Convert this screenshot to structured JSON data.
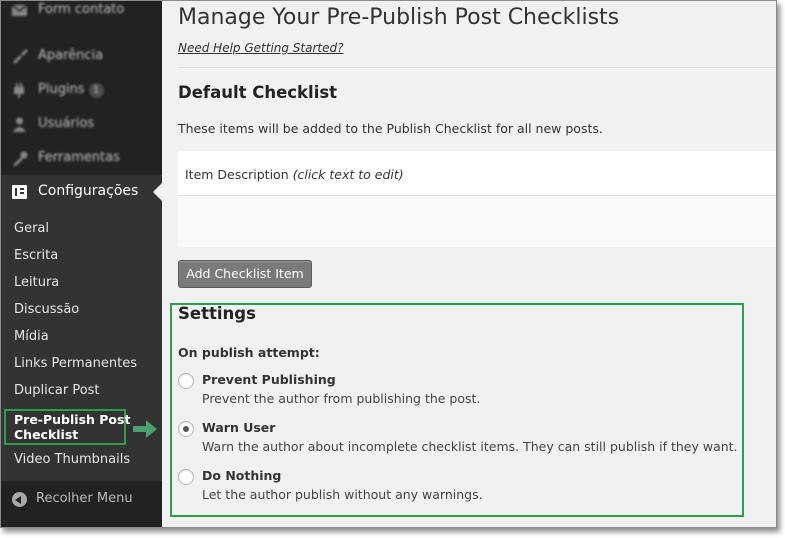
{
  "sidebar": {
    "top_items": [
      {
        "label": "Form contato",
        "icon": "mail-icon"
      },
      {
        "label": "Aparência",
        "icon": "paintbrush-icon"
      },
      {
        "label": "Plugins",
        "icon": "plug-icon",
        "badge": "1"
      },
      {
        "label": "Usuários",
        "icon": "users-icon"
      },
      {
        "label": "Ferramentas",
        "icon": "wrench-icon"
      }
    ],
    "current_menu": {
      "label": "Configurações",
      "icon": "settings-sliders-icon"
    },
    "submenu": [
      "Geral",
      "Escrita",
      "Leitura",
      "Discussão",
      "Mídia",
      "Links Permanentes",
      "Duplicar Post"
    ],
    "current_sub_line1": "Pre-Publish Post",
    "current_sub_line2": "Checklist",
    "after_current": "Video Thumbnails",
    "collapse_label": "Recolher Menu",
    "highlight_color": "#2e9e4e"
  },
  "main": {
    "title": "Manage Your Pre-Publish Post Checklists",
    "help_link": "Need Help Getting Started?",
    "default_checklist": {
      "title": "Default Checklist",
      "description": "These items will be added to the Publish Checklist for all new posts.",
      "column_header": "Item Description",
      "column_hint": "(click text to edit)",
      "add_button": "Add Checklist Item"
    },
    "settings": {
      "title": "Settings",
      "publish_label": "On publish attempt:",
      "options": [
        {
          "label": "Prevent Publishing",
          "description": "Prevent the author from publishing the post.",
          "checked": false
        },
        {
          "label": "Warn User",
          "description": "Warn the author about incomplete checklist items. They can still publish if they want.",
          "checked": true
        },
        {
          "label": "Do Nothing",
          "description": "Let the author publish without any warnings.",
          "checked": false
        }
      ]
    }
  }
}
